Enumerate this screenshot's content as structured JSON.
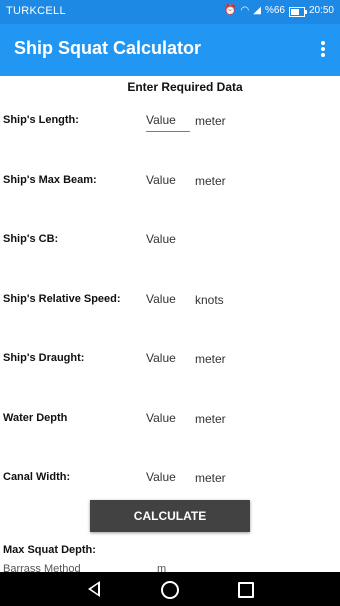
{
  "status_bar": {
    "carrier": "TURKCELL",
    "battery": "%66",
    "time": "20:50",
    "battery_level": 0.66
  },
  "app_bar": {
    "title": "Ship Squat Calculator"
  },
  "form": {
    "heading": "Enter Required Data",
    "fields": [
      {
        "label": "Ship's Length:",
        "placeholder": "Value",
        "unit": "meter"
      },
      {
        "label": "Ship's Max Beam:",
        "placeholder": "Value",
        "unit": "meter"
      },
      {
        "label": "Ship's CB:",
        "placeholder": "Value",
        "unit": ""
      },
      {
        "label": "Ship's Relative Speed:",
        "placeholder": "Value",
        "unit": "knots"
      },
      {
        "label": "Ship's Draught:",
        "placeholder": "Value",
        "unit": "meter"
      },
      {
        "label": "Water Depth",
        "placeholder": "Value",
        "unit": "meter"
      },
      {
        "label": "Canal Width:",
        "placeholder": "Value",
        "unit": "meter"
      }
    ],
    "calculate_label": "CALCULATE"
  },
  "results": {
    "max_squat_label": "Max Squat Depth:",
    "method_label": "Barrass Method",
    "method_unit": "m"
  },
  "colors": {
    "status_bar": "#1e88e5",
    "app_bar": "#2196f3",
    "button": "#424242",
    "nav_bar": "#000000"
  },
  "icons": {
    "status": [
      "alarm-icon",
      "wifi-icon",
      "signal-icon",
      "battery-icon"
    ],
    "app_bar": [
      "overflow-menu-icon"
    ],
    "nav": [
      "back-icon",
      "home-icon",
      "recents-icon"
    ]
  }
}
